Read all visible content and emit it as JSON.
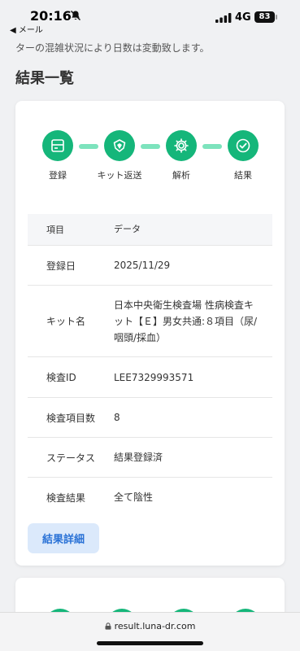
{
  "status_bar": {
    "time": "20:16",
    "back_label": "◀ メール",
    "network": "4G",
    "battery": "83"
  },
  "notice_text": "ターの混雑状況により日数は変動致します。",
  "page_title": "結果一覧",
  "steps": [
    {
      "label": "登録",
      "icon": "register-icon"
    },
    {
      "label": "キット返送",
      "icon": "shield-icon"
    },
    {
      "label": "解析",
      "icon": "gear-icon"
    },
    {
      "label": "結果",
      "icon": "check-circle-icon"
    }
  ],
  "table": {
    "header": {
      "col1": "項目",
      "col2": "データ"
    },
    "rows": [
      {
        "label": "登録日",
        "value": "2025/11/29"
      },
      {
        "label": "キット名",
        "value": "日本中央衛生検査場 性病検査キット【Ｅ】男女共通:８項目（尿/咽頭/採血）"
      },
      {
        "label": "検査ID",
        "value": "LEE7329993571"
      },
      {
        "label": "検査項目数",
        "value": "8"
      },
      {
        "label": "ステータス",
        "value": "結果登録済"
      },
      {
        "label": "検査結果",
        "value": "全て陰性"
      }
    ]
  },
  "detail_button": "結果詳細",
  "url": "result.luna-dr.com",
  "colors": {
    "accent_green": "#15b67a",
    "connector_green": "#7de3bd",
    "button_bg": "#dbe9fb",
    "button_text": "#2a72d6"
  }
}
